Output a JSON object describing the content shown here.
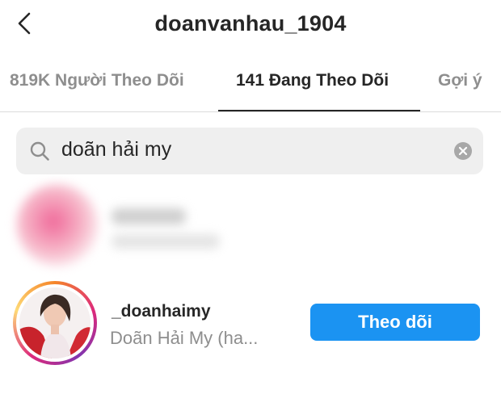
{
  "header": {
    "title": "doanvanhau_1904",
    "back_icon": "chevron-left-icon"
  },
  "tabs": [
    {
      "label": "819K Người Theo Dõi",
      "active": false
    },
    {
      "label": "141 Đang Theo Dõi",
      "active": true
    },
    {
      "label": "Gợi ý",
      "active": false
    }
  ],
  "search": {
    "icon": "search-icon",
    "query": "doãn hải my",
    "clear_icon": "clear-circle-icon"
  },
  "results": [
    {
      "blurred": true
    },
    {
      "username": "_doanhaimy",
      "full_name": "Doãn Hải My (ha...",
      "story_ring": true,
      "follow_label": "Theo dõi",
      "follow_color": "#1b93f2"
    }
  ],
  "colors": {
    "text_primary": "#262626",
    "text_secondary": "#8e8e8e",
    "search_bg": "#efefef",
    "accent": "#1b93f2"
  }
}
